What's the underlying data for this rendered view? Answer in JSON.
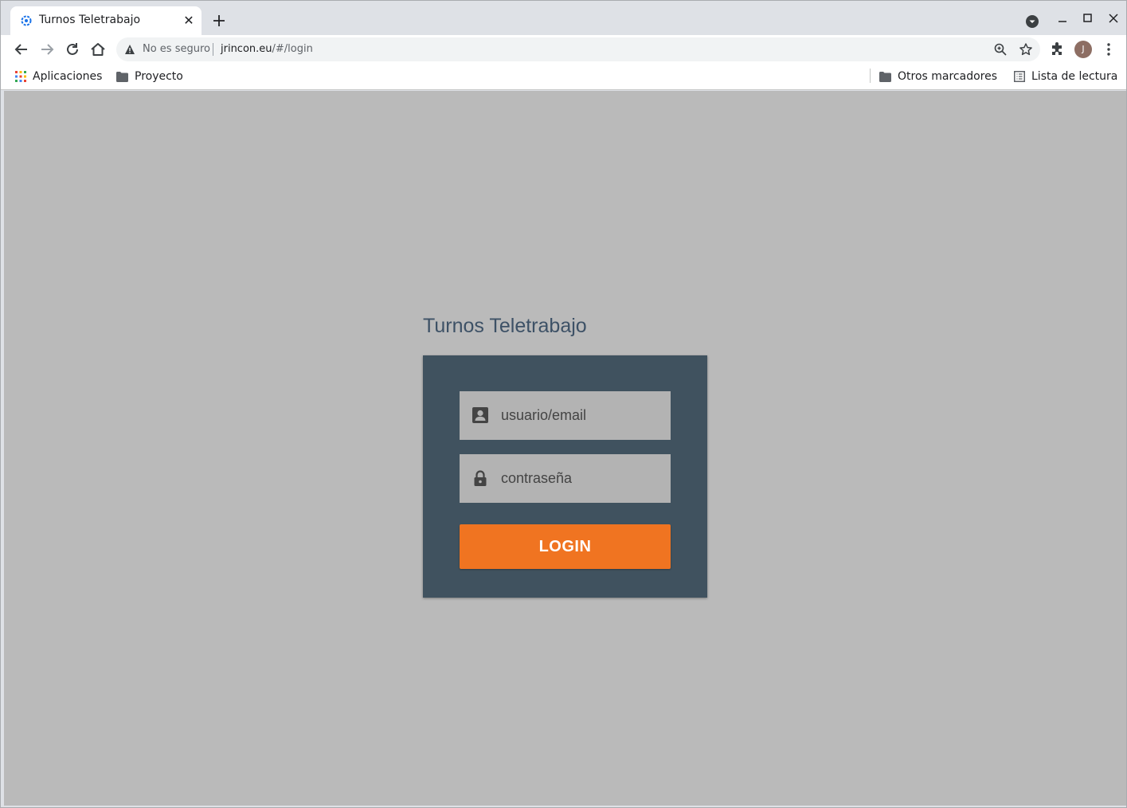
{
  "browser": {
    "tab": {
      "title": "Turnos Teletrabajo",
      "close_glyph": "✕",
      "favicon": "gear-favicon-icon"
    },
    "new_tab_icon": "plus-icon",
    "window_controls": [
      "tab-search-icon",
      "minimize-icon",
      "maximize-icon",
      "close-window-icon"
    ],
    "toolbar": {
      "buttons": [
        "back-arrow-icon",
        "forward-arrow-icon",
        "reload-icon",
        "home-icon"
      ],
      "security_label": "No es seguro",
      "url_host": "jrincon.eu",
      "url_path": "/#/login",
      "right_icons": [
        "zoom-icon",
        "star-icon",
        "extensions-icon",
        "menu-kebab-icon"
      ],
      "profile_initial": "J"
    },
    "bookmarks": {
      "left": [
        {
          "label": "Aplicaciones",
          "icon": "apps-grid-icon"
        },
        {
          "label": "Proyecto",
          "icon": "folder-icon"
        }
      ],
      "right": [
        {
          "label": "Otros marcadores",
          "icon": "folder-icon"
        },
        {
          "label": "Lista de lectura",
          "icon": "reading-list-icon"
        }
      ]
    }
  },
  "page": {
    "title": "Turnos Teletrabajo",
    "username": {
      "placeholder": "usuario/email",
      "value": "",
      "icon": "account-box-icon"
    },
    "password": {
      "placeholder": "contraseña",
      "value": "",
      "icon": "lock-icon"
    },
    "login_label": "LOGIN"
  },
  "colors": {
    "background": "#bababa",
    "card": "#40525f",
    "field": "#b3b3b3",
    "accent": "#f07421",
    "title": "#3d5166"
  }
}
